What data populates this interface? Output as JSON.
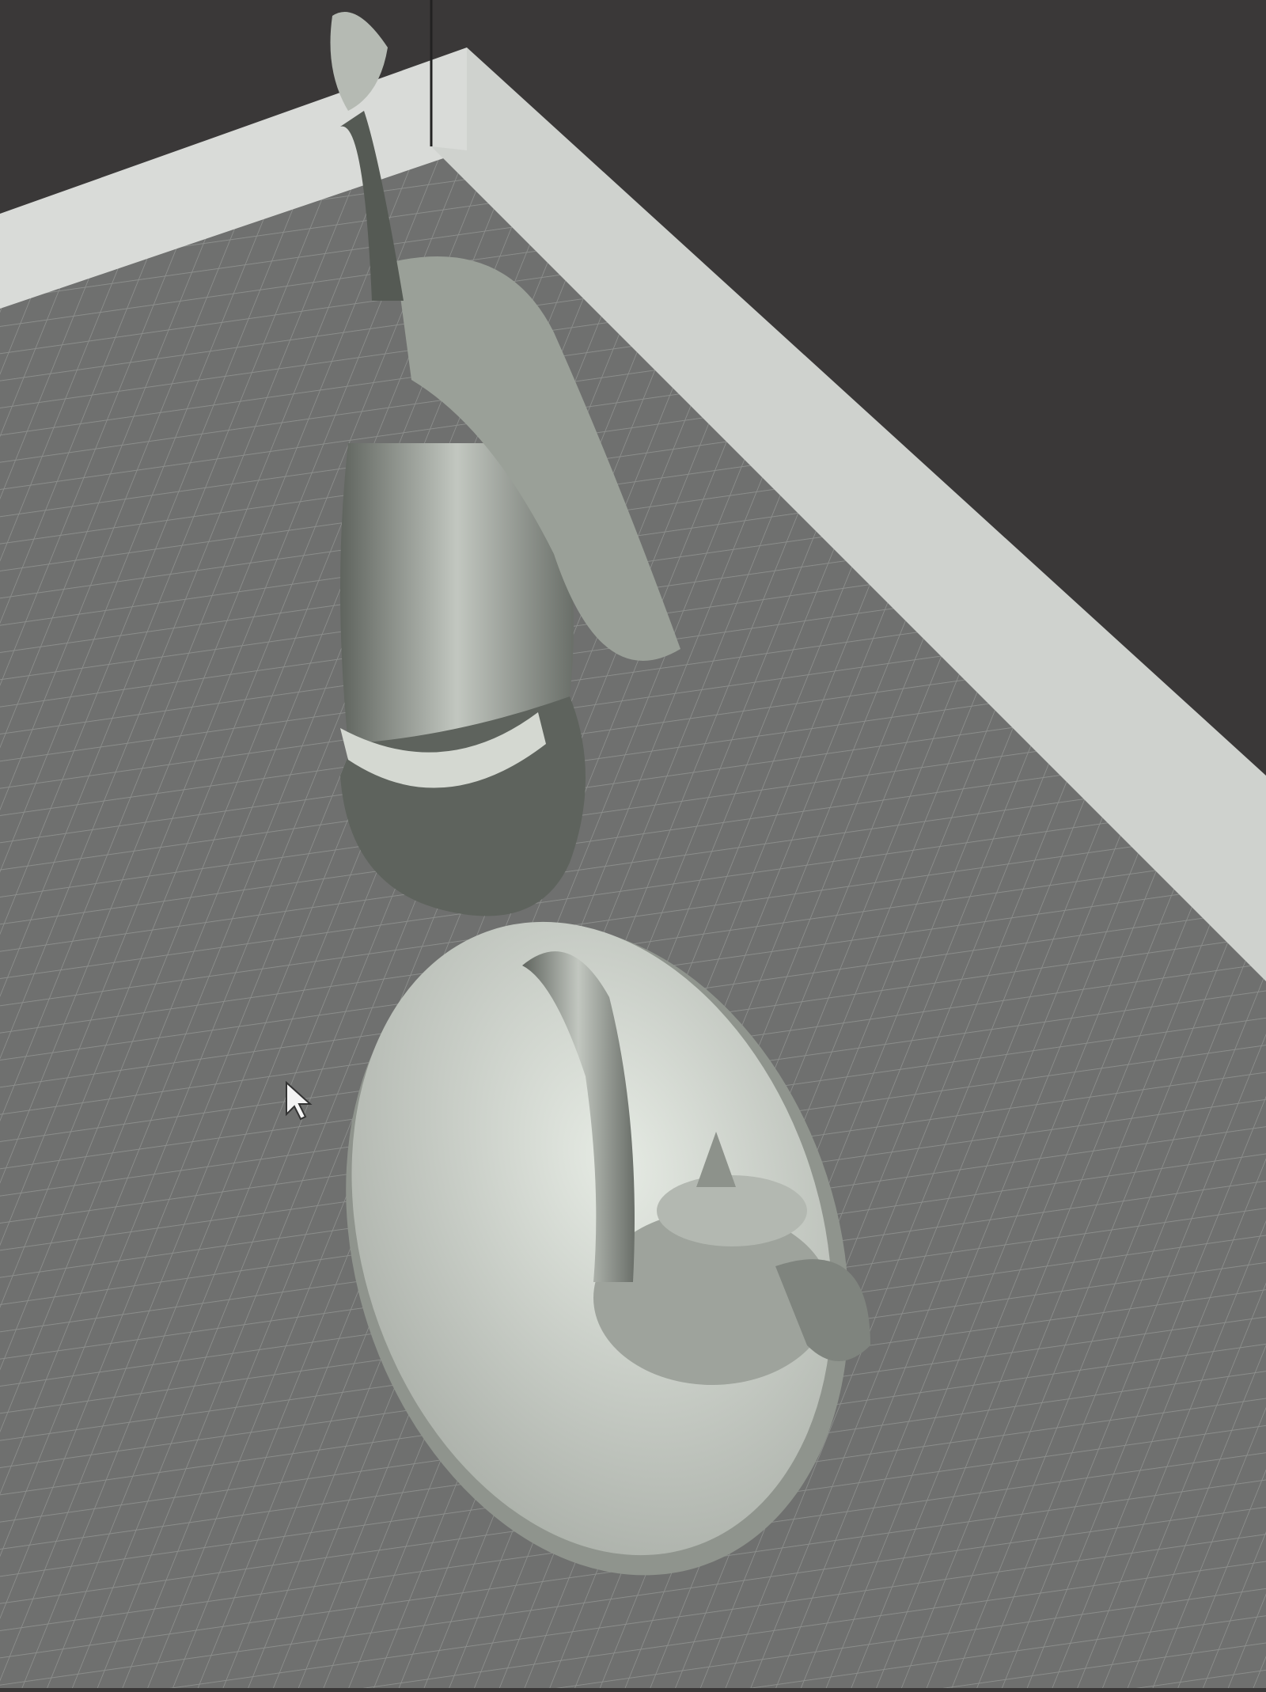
{
  "viewport": {
    "name": "slicer-3d-viewport",
    "colors": {
      "background": "#3a3838",
      "build_plate": "#6f706f",
      "grid_line": "#8c8e8c",
      "wall": "#d9dbd8",
      "model": "#b9beb8",
      "model_shadow": "#5c605b"
    }
  },
  "cursor": {
    "icon": "mouse-pointer-icon"
  }
}
